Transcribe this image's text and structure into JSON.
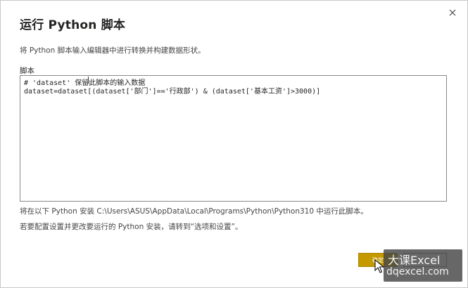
{
  "dialog": {
    "title": "运行 Python 脚本",
    "subtitle": "将 Python 脚本输入编辑器中进行转换并构建数据形状。",
    "script_label": "脚本",
    "close_icon": "close-icon"
  },
  "editor": {
    "lines": [
      "# 'dataset' 保留此脚本的输入数据",
      "dataset=dataset[(dataset['部门']=='行政部') & (dataset['基本工资']>3000)]"
    ]
  },
  "info": {
    "line1": "将在以下 Python 安装 C:\\Users\\ASUS\\AppData\\Local\\Programs\\Python\\Python310 中运行此脚本。",
    "line2": "若要配置设置并更改要运行的 Python 安装，请转到“选项和设置”。"
  },
  "buttons": {
    "ok_label": "确定",
    "cancel_label": ""
  },
  "watermark": {
    "line1": "大课Excel",
    "line2": "dqexcel.com"
  },
  "colors": {
    "ok_button": "#c49a00",
    "watermark_bg": "#464646"
  }
}
